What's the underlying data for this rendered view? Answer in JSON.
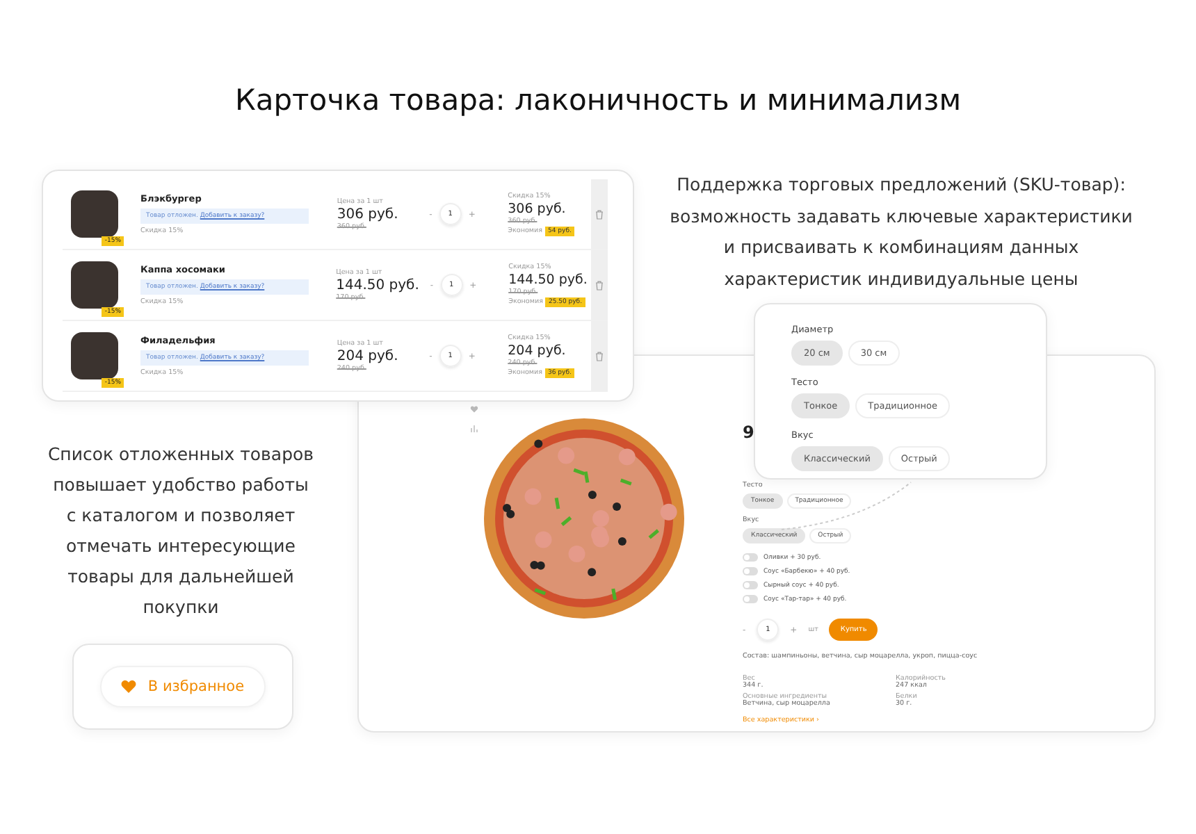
{
  "title": "Карточка товара: лаконичность и минимализм",
  "wishlist_panel": {
    "rows": [
      {
        "name": "Блэкбургер",
        "note": "Товар отложен.",
        "note_link": "Добавить к заказу?",
        "discount_label": "Скидка",
        "discount": "15%",
        "badge": "-15%",
        "price_label": "Цена за 1 шт",
        "price": "306 руб.",
        "old_price": "360 руб.",
        "minus": "-",
        "quantity": "1",
        "plus": "+",
        "total_discount": "Скидка 15%",
        "total": "306 руб.",
        "total_old": "360 руб.",
        "saving_label": "Экономия",
        "saving": "54 руб."
      },
      {
        "name": "Каппа хосомаки",
        "note": "Товар отложен.",
        "note_link": "Добавить к заказу?",
        "discount_label": "Скидка",
        "discount": "15%",
        "badge": "-15%",
        "price_label": "Цена за 1 шт",
        "price": "144.50 руб.",
        "old_price": "170 руб.",
        "minus": "-",
        "quantity": "1",
        "plus": "+",
        "total_discount": "Скидка 15%",
        "total": "144.50 руб.",
        "total_old": "170 руб.",
        "saving_label": "Экономия",
        "saving": "25.50 руб."
      },
      {
        "name": "Филадельфия",
        "note": "Товар отложен.",
        "note_link": "Добавить к заказу?",
        "discount_label": "Скидка",
        "discount": "15%",
        "badge": "-15%",
        "price_label": "Цена за 1 шт",
        "price": "204 руб.",
        "old_price": "240 руб.",
        "minus": "-",
        "quantity": "1",
        "plus": "+",
        "total_discount": "Скидка 15%",
        "total": "204 руб.",
        "total_old": "240 руб.",
        "saving_label": "Экономия",
        "saving": "36 руб."
      }
    ]
  },
  "sku_text": {
    "lines": [
      "Поддержка торговых предложений (SKU-товар):",
      "возможность задавать ключевые характеристики",
      "и присваивать к комбинациям данных",
      "характеристик индивидуальные цены"
    ]
  },
  "wishlist_text": {
    "lines": [
      "Список отложенных товаров",
      "повышает удобство работы",
      "с каталогом и позволяет",
      "отмечать интересующие",
      "товары для дальнейшей",
      "покупки"
    ]
  },
  "favorite_button": {
    "label": "В избранное"
  },
  "product_card": {
    "price": "9",
    "options": [
      {
        "label": "Тесто",
        "chips": [
          {
            "label": "Тонкое",
            "selected": true
          },
          {
            "label": "Традиционное",
            "selected": false
          }
        ]
      },
      {
        "label": "Вкус",
        "chips": [
          {
            "label": "Классический",
            "selected": true
          },
          {
            "label": "Острый",
            "selected": false
          }
        ]
      }
    ],
    "addons": [
      {
        "label": "Оливки + 30 руб.",
        "on": false
      },
      {
        "label": "Соус «Барбекю» + 40 руб.",
        "on": false
      },
      {
        "label": "Сырный соус + 40 руб.",
        "on": false
      },
      {
        "label": "Соус «Тар-тар» + 40 руб.",
        "on": false
      }
    ],
    "quantity": {
      "minus": "-",
      "value": "1",
      "plus": "+",
      "unit": "шт"
    },
    "buy_button": "Купить",
    "composition": "Состав: шампиньоны, ветчина, сыр моцарелла, укроп, пицца-соус",
    "specs": [
      {
        "label": "Вес",
        "value": "344 г."
      },
      {
        "label": "Калорийность",
        "value": "247 ккал"
      },
      {
        "label": "Основные ингредиенты",
        "value": "Ветчина, сыр моцарелла"
      },
      {
        "label": "Белки",
        "value": "30 г."
      }
    ],
    "all_specs_link": "Все характеристики ›"
  },
  "sku_popover": {
    "groups": [
      {
        "label": "Диаметр",
        "chips": [
          {
            "label": "20 см",
            "selected": true
          },
          {
            "label": "30 см",
            "selected": false
          }
        ]
      },
      {
        "label": "Тесто",
        "chips": [
          {
            "label": "Тонкое",
            "selected": true
          },
          {
            "label": "Традиционное",
            "selected": false
          }
        ]
      },
      {
        "label": "Вкус",
        "chips": [
          {
            "label": "Классический",
            "selected": true
          },
          {
            "label": "Острый",
            "selected": false
          }
        ]
      }
    ]
  }
}
